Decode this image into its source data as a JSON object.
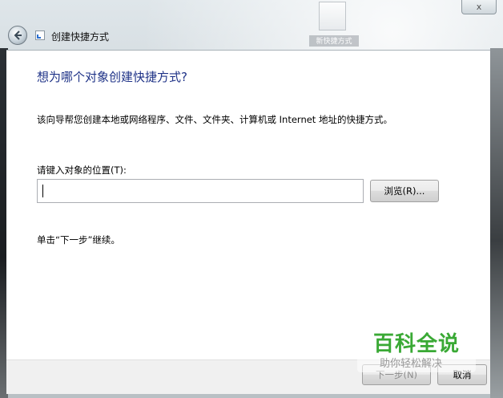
{
  "window": {
    "title": "创建快捷方式",
    "close_glyph": "x",
    "desktop_icon_label": "新快捷方式"
  },
  "main": {
    "heading": "想为哪个对象创建快捷方式?",
    "description": "该向导帮您创建本地或网络程序、文件、文件夹、计算机或 Internet 地址的快捷方式。",
    "location_label": "请键入对象的位置(T):",
    "location_value": "",
    "browse_label": "浏览(R)...",
    "hint": "单击“下一步”继续。"
  },
  "footer": {
    "next_label": "下一步(N)",
    "cancel_label": "取消"
  },
  "watermark": {
    "title": "百科全说",
    "subtitle": "助你轻松解决"
  },
  "colors": {
    "heading": "#1e3287",
    "watermark_green": "#3aa935"
  }
}
